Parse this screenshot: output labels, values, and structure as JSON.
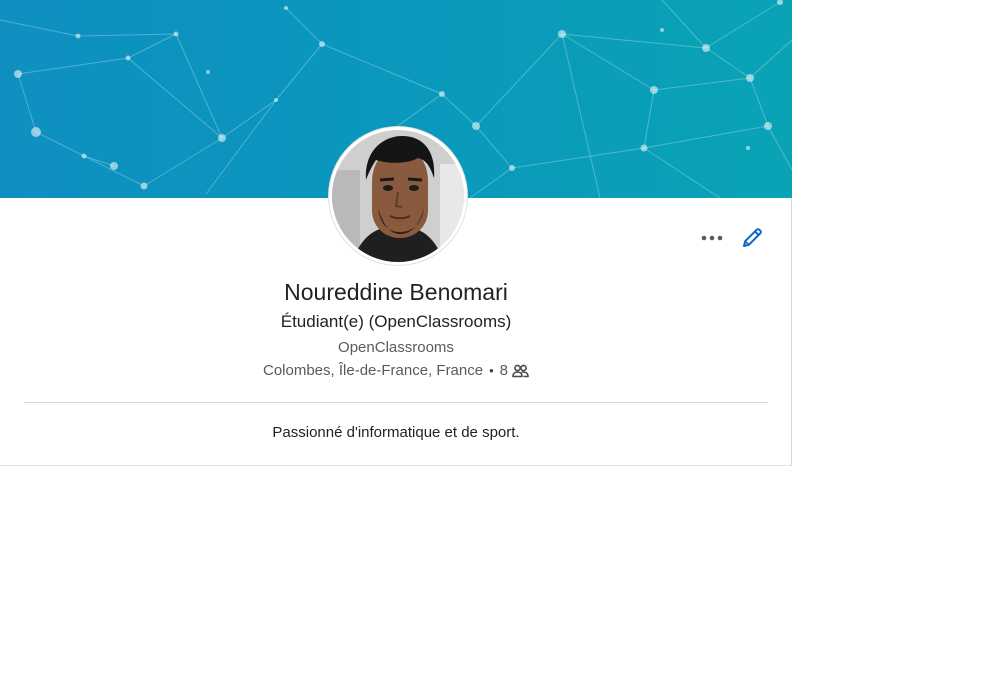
{
  "profile": {
    "name": "Noureddine Benomari",
    "headline": "Étudiant(e) (OpenClassrooms)",
    "company": "OpenClassrooms",
    "location": "Colombes, Île-de-France, France",
    "separator": "•",
    "connections_count": "8",
    "summary": "Passionné d'informatique et de sport."
  },
  "icons": {
    "more": "more-horizontal-icon",
    "edit": "pencil-icon",
    "connections": "people-icon"
  },
  "colors": {
    "banner_start": "#0e8fc0",
    "banner_end": "#0aa3b5",
    "edit_accent": "#0a66c2",
    "text_primary": "#222222",
    "text_secondary": "#5a5a5a"
  }
}
